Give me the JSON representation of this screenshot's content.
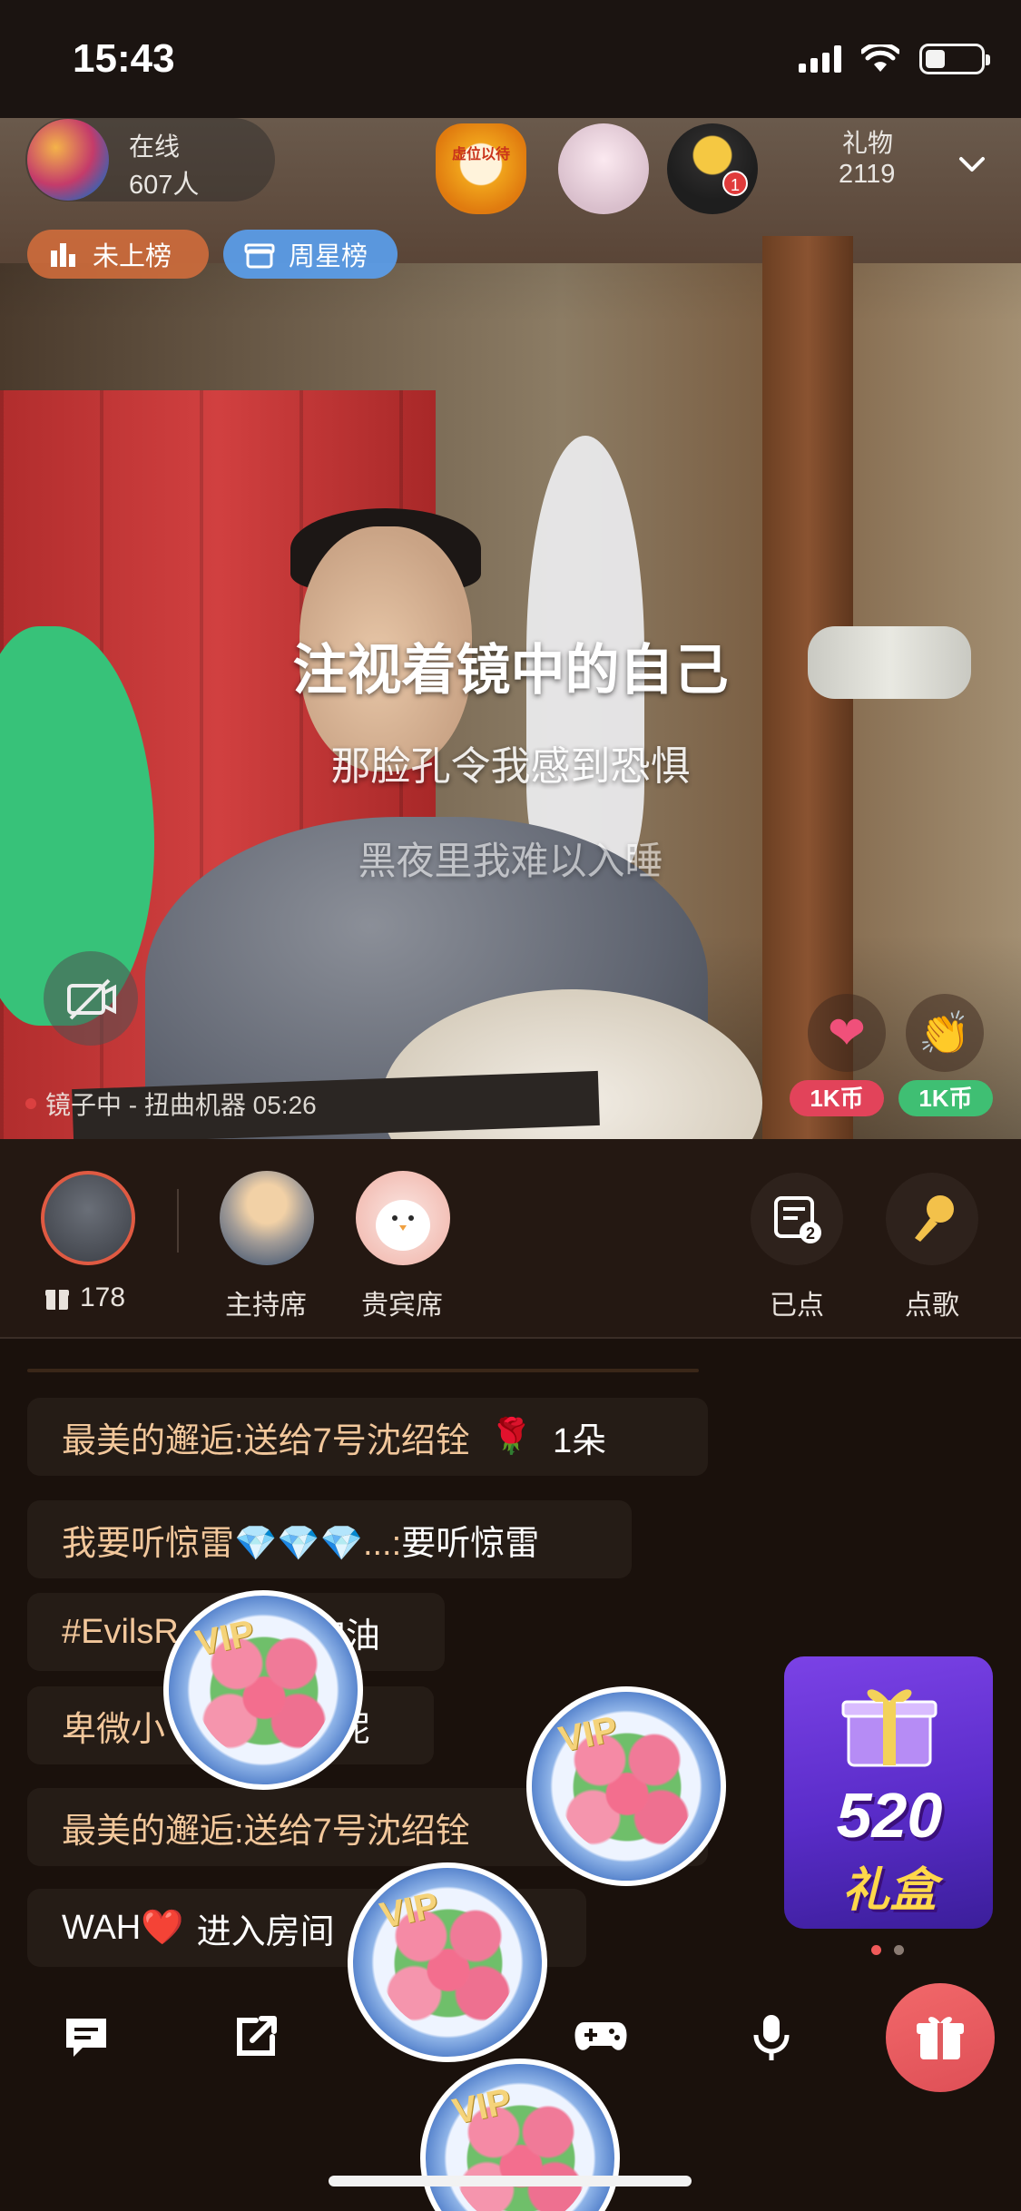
{
  "status_bar": {
    "time": "15:43"
  },
  "room": {
    "online_label": "在线",
    "online_count": "607人",
    "badge_seat_text": "虚位以待",
    "badge_avatar_number": "1",
    "gift_label": "礼物",
    "gift_count": "2119",
    "rank_pills": {
      "unranked": "未上榜",
      "weekly_star": "周星榜"
    }
  },
  "lyrics": {
    "current": "注视着镜中的自己",
    "next": "那脸孔令我感到恐惧",
    "faded": "黑夜里我难以入睡"
  },
  "now_playing": "镜子中 - 扭曲机器 05:26",
  "gift_shortcuts": [
    {
      "icon": "heart-gift-icon",
      "coin": "1K币"
    },
    {
      "icon": "clap-gift-icon",
      "coin": "1K币"
    }
  ],
  "seats": {
    "host_gift_count": "178",
    "host_seat_label": "主持席",
    "vip_seat_label": "贵宾席",
    "played_label": "已点",
    "played_count": "2",
    "request_label": "点歌"
  },
  "chat": [
    {
      "name": "最美的邂逅:",
      "text": "送给7号沈绍铨",
      "suffix": "1朵"
    },
    {
      "name": "我要听惊雷💎💎💎...:",
      "text": "要听惊雷"
    },
    {
      "name": "#EvilsR",
      "text": "加油"
    },
    {
      "name": "卑微小",
      "text": "呢"
    },
    {
      "name": "最美的邂逅:",
      "text": "送给7号沈绍铨"
    },
    {
      "name": "WAH❤️",
      "text": "进入房间"
    }
  ],
  "promo": {
    "title": "520",
    "subtitle": "礼盒",
    "vip_tag": "VIP"
  },
  "colors": {
    "accent_red": "#e2435a",
    "accent_green": "#3fbf73",
    "chat_name": "#f2c79b",
    "promo_purple": "#6a35d8"
  }
}
